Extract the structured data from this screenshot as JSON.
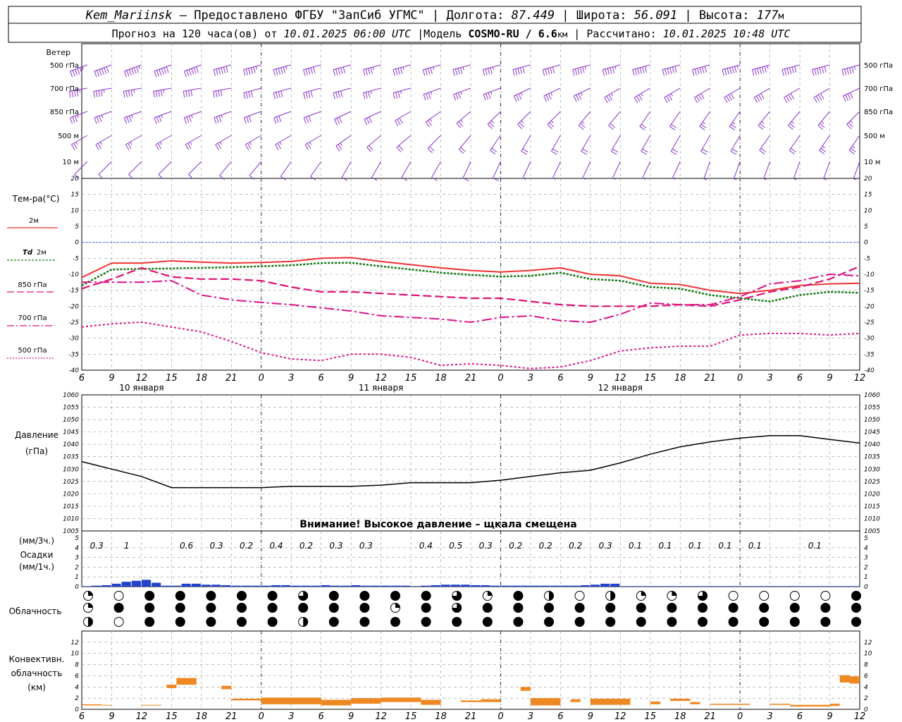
{
  "header": {
    "line1": {
      "station": "Kem_Mariinsk",
      "provider": "– Предоставлено ФГБУ \"ЗапСиб УГМС\"",
      "lon_label": "Долгота:",
      "lon": "87.449",
      "lat_label": "Широта:",
      "lat": "56.091",
      "alt_label": "Высота:",
      "alt": "177",
      "alt_unit": "м"
    },
    "line2": {
      "forecast_label": "Прогноз на 120 часа(ов) от",
      "forecast_time": "10.01.2025 06:00 UTC",
      "model_label": "|Модель",
      "model": "COSMO-RU / 6.6",
      "model_unit": "км",
      "calc_label": "| Рассчитано:",
      "calc_time": "10.01.2025 10:48 UTC"
    }
  },
  "labels": {
    "wind": "Ветер",
    "wind_levels": [
      "500 гПа",
      "700 гПа",
      "850 гПа",
      "500 м",
      "10 м"
    ],
    "temp": "Тем-ра(°С)",
    "legend_2m": "2м",
    "legend_td": "Td",
    "legend_td_2m": "2м",
    "legend_850": "850 гПа",
    "legend_700": "700 гПа",
    "legend_500": "500 гПа",
    "pressure_1": "Давление",
    "pressure_2": "(гПа)",
    "pressure_warning": "Внимание! Высокое давление – щкала смещена",
    "precip_1": "(мм/3ч.)",
    "precip_2": "Осадки",
    "precip_3": "(мм/1ч.)",
    "cloud": "Облачность",
    "conv_1": "Конвективн.",
    "conv_2": "облачность",
    "conv_3": "(км)"
  },
  "colors": {
    "temp2m": "#ee3333",
    "td2m": "#117711",
    "t850": "#dd1177",
    "t700": "#dd1188",
    "t500": "#dd1188",
    "wind": "#8833cc",
    "precip": "#2244cc",
    "conv": "#ee8822",
    "zero": "#3355ff"
  },
  "chart_data": [
    {
      "type": "line",
      "title": "Тем-ра(°С)",
      "x_hours": [
        0,
        3,
        6,
        9,
        12,
        15,
        18,
        21,
        24,
        27,
        30,
        33,
        36,
        39,
        42,
        45,
        48,
        51,
        54,
        57,
        60,
        63,
        66,
        69,
        72,
        75,
        78
      ],
      "x_tick_labels": [
        "6",
        "9",
        "12",
        "15",
        "18",
        "21",
        "0",
        "3",
        "6",
        "9",
        "12",
        "15",
        "18",
        "21",
        "0",
        "3",
        "6",
        "9",
        "12",
        "15",
        "18",
        "21",
        "0",
        "3",
        "6",
        "9",
        "12"
      ],
      "date_labels": [
        {
          "hour": 6,
          "text": "10 января"
        },
        {
          "hour": 30,
          "text": "11 января"
        },
        {
          "hour": 54,
          "text": "12 января"
        }
      ],
      "ylim": [
        -40,
        20
      ],
      "y_ticks": [
        20,
        15,
        10,
        5,
        0,
        -5,
        -10,
        -15,
        -20,
        -25,
        -30,
        -35,
        -40
      ],
      "series": [
        {
          "name": "2м",
          "values": [
            -11,
            -6.5,
            -6.5,
            -5.8,
            -6.2,
            -6.5,
            -6.3,
            -6,
            -5,
            -4.8,
            -6,
            -7,
            -8,
            -8.8,
            -9.3,
            -8.8,
            -8,
            -10,
            -10.5,
            -12.8,
            -13.2,
            -15,
            -16,
            -15,
            -13.5,
            -13,
            -12.8
          ]
        },
        {
          "name": "Td 2м",
          "values": [
            -13.5,
            -8.5,
            -8.3,
            -8.2,
            -8,
            -7.8,
            -7.5,
            -7.2,
            -6.5,
            -6.4,
            -7.5,
            -8.5,
            -9.5,
            -10.2,
            -10.7,
            -10.5,
            -9.5,
            -11.5,
            -12,
            -14,
            -14.5,
            -16.5,
            -17.5,
            -18.5,
            -16.5,
            -15.5,
            -15.8
          ]
        },
        {
          "name": "850 гПа",
          "values": [
            -14.5,
            -11.5,
            -8,
            -10.8,
            -11.5,
            -11.5,
            -12,
            -14,
            -15.5,
            -15.5,
            -16,
            -16.5,
            -17,
            -17.5,
            -17.5,
            -18.5,
            -19.5,
            -20,
            -20,
            -20,
            -19.5,
            -20,
            -18,
            -15.5,
            -14,
            -11.5,
            -7.5
          ]
        },
        {
          "name": "700 гПа",
          "values": [
            -12.5,
            -12.5,
            -12.5,
            -12,
            -16.5,
            -18,
            -18.8,
            -19.5,
            -20.5,
            -21.5,
            -23,
            -23.5,
            -24,
            -25,
            -23.5,
            -23,
            -24.5,
            -25,
            -22.5,
            -19,
            -19.5,
            -19.5,
            -17,
            -13,
            -12,
            -10,
            -10.5
          ]
        },
        {
          "name": "500 гПа",
          "values": [
            -26.5,
            -25.5,
            -25,
            -26.5,
            -28,
            -31,
            -34.5,
            -36.5,
            -37,
            -35,
            -35,
            -36,
            -38.5,
            -38,
            -38.5,
            -39.5,
            -39,
            -37,
            -34,
            -33,
            -32.5,
            -32.5,
            -29,
            -28.5,
            -28.5,
            -29,
            -28.5
          ]
        }
      ]
    },
    {
      "type": "line",
      "title": "Давление",
      "ylabel": "(гПа)",
      "x_hours": [
        0,
        3,
        6,
        9,
        12,
        15,
        18,
        21,
        24,
        27,
        30,
        33,
        36,
        39,
        42,
        45,
        48,
        51,
        54,
        57,
        60,
        63,
        66,
        69,
        72,
        75,
        78
      ],
      "ylim": [
        1005,
        1060
      ],
      "y_ticks": [
        1060,
        1055,
        1050,
        1045,
        1040,
        1035,
        1030,
        1025,
        1020,
        1015,
        1010,
        1005
      ],
      "series": [
        {
          "name": "Давление",
          "values": [
            1033,
            1030,
            1027,
            1022.5,
            1022.5,
            1022.5,
            1022.5,
            1023,
            1023,
            1023,
            1023.5,
            1024.5,
            1024.5,
            1024.5,
            1025.5,
            1027,
            1028.5,
            1029.5,
            1032.5,
            1036,
            1039,
            1041,
            1042.5,
            1043.5,
            1043.5,
            1042,
            1040.5
          ]
        }
      ]
    },
    {
      "type": "bar",
      "title": "Осадки",
      "ylim": [
        0,
        5
      ],
      "y_ticks": [
        5,
        4,
        3,
        2,
        1,
        0
      ],
      "three_hour_labels": [
        {
          "hour": 1.5,
          "text": "0.3"
        },
        {
          "hour": 4.5,
          "text": "1"
        },
        {
          "hour": 10.5,
          "text": "0.6"
        },
        {
          "hour": 13.5,
          "text": "0.3"
        },
        {
          "hour": 16.5,
          "text": "0.2"
        },
        {
          "hour": 19.5,
          "text": "0.4"
        },
        {
          "hour": 22.5,
          "text": "0.2"
        },
        {
          "hour": 25.5,
          "text": "0.3"
        },
        {
          "hour": 28.5,
          "text": "0.3"
        },
        {
          "hour": 34.5,
          "text": "0.4"
        },
        {
          "hour": 37.5,
          "text": "0.5"
        },
        {
          "hour": 40.5,
          "text": "0.3"
        },
        {
          "hour": 43.5,
          "text": "0.2"
        },
        {
          "hour": 46.5,
          "text": "0.2"
        },
        {
          "hour": 49.5,
          "text": "0.2"
        },
        {
          "hour": 52.5,
          "text": "0.3"
        },
        {
          "hour": 55.5,
          "text": "0.1"
        },
        {
          "hour": 58.5,
          "text": "0.1"
        },
        {
          "hour": 61.5,
          "text": "0.1"
        },
        {
          "hour": 64.5,
          "text": "0.1"
        },
        {
          "hour": 67.5,
          "text": "0.1"
        },
        {
          "hour": 73.5,
          "text": "0.1"
        }
      ],
      "hourly_mm": [
        0.05,
        0.1,
        0.15,
        0.3,
        0.5,
        0.6,
        0.7,
        0.4,
        0.1,
        0.1,
        0.3,
        0.3,
        0.2,
        0.2,
        0.15,
        0.1,
        0.1,
        0.1,
        0.1,
        0.15,
        0.15,
        0.1,
        0.1,
        0.1,
        0.15,
        0.1,
        0.1,
        0.15,
        0.1,
        0.1,
        0.1,
        0.1,
        0.1,
        0.05,
        0.1,
        0.15,
        0.2,
        0.2,
        0.2,
        0.15,
        0.15,
        0.1,
        0.1,
        0.1,
        0.1,
        0.1,
        0.1,
        0.1,
        0.1,
        0.1,
        0.15,
        0.2,
        0.3,
        0.3,
        0.05,
        0.05,
        0.05,
        0.05,
        0.05,
        0.05,
        0.05,
        0.05,
        0.05,
        0.05,
        0.05,
        0.05,
        0.05,
        0.05,
        0.05,
        0.05,
        0.05,
        0.05,
        0.05,
        0.05,
        0.05,
        0.05,
        0.05,
        0.05
      ]
    },
    {
      "type": "table",
      "title": "Облачность",
      "columns": 26,
      "rows": [
        "302222242222432101334000021102000000000000000000000000000000000000000000000000000000000000000000",
        "322222222232422222222222222222222222222222222222222222222222222222222222222222222222222222222223",
        "102222212222222222222222222222222222222222222222222222222222222222222222222222222222222222222222"
      ]
    },
    {
      "type": "bar",
      "title": "Конвективн. облачность",
      "ylabel": "(км)",
      "ylim": [
        0,
        14
      ],
      "y_ticks": [
        12,
        10,
        8,
        6,
        4,
        2,
        0
      ],
      "segments_km": [
        {
          "h0": 0,
          "h1": 2,
          "bottom": 0.7,
          "top": 0.9
        },
        {
          "h0": 2,
          "h1": 3,
          "bottom": 0.7,
          "top": 0.8
        },
        {
          "h0": 6,
          "h1": 8,
          "bottom": 0.7,
          "top": 0.8
        },
        {
          "h0": 8.5,
          "h1": 9.5,
          "bottom": 3.8,
          "top": 4.4
        },
        {
          "h0": 9.5,
          "h1": 11.5,
          "bottom": 4.4,
          "top": 5.6
        },
        {
          "h0": 14,
          "h1": 15,
          "bottom": 3.6,
          "top": 4.2
        },
        {
          "h0": 15,
          "h1": 18,
          "bottom": 1.6,
          "top": 1.9
        },
        {
          "h0": 18,
          "h1": 24,
          "bottom": 0.9,
          "top": 2.1
        },
        {
          "h0": 24,
          "h1": 27,
          "bottom": 0.7,
          "top": 1.7
        },
        {
          "h0": 27,
          "h1": 30,
          "bottom": 1,
          "top": 2
        },
        {
          "h0": 30,
          "h1": 34,
          "bottom": 1.3,
          "top": 2.1
        },
        {
          "h0": 34,
          "h1": 36,
          "bottom": 0.8,
          "top": 1.7
        },
        {
          "h0": 38,
          "h1": 40,
          "bottom": 1.3,
          "top": 1.6
        },
        {
          "h0": 40,
          "h1": 42,
          "bottom": 1.3,
          "top": 1.8
        },
        {
          "h0": 44,
          "h1": 45,
          "bottom": 3.3,
          "top": 4
        },
        {
          "h0": 45,
          "h1": 48,
          "bottom": 0.7,
          "top": 2
        },
        {
          "h0": 49,
          "h1": 50,
          "bottom": 1.3,
          "top": 1.8
        },
        {
          "h0": 51,
          "h1": 55,
          "bottom": 0.8,
          "top": 1.9
        },
        {
          "h0": 57,
          "h1": 58,
          "bottom": 0.9,
          "top": 1.4
        },
        {
          "h0": 59,
          "h1": 61,
          "bottom": 1.5,
          "top": 1.9
        },
        {
          "h0": 61,
          "h1": 62,
          "bottom": 0.9,
          "top": 1.3
        },
        {
          "h0": 63,
          "h1": 67,
          "bottom": 0.8,
          "top": 1
        },
        {
          "h0": 69,
          "h1": 71,
          "bottom": 0.8,
          "top": 1
        },
        {
          "h0": 71,
          "h1": 75,
          "bottom": 0.5,
          "top": 0.8
        },
        {
          "h0": 75,
          "h1": 76,
          "bottom": 0.6,
          "top": 1
        },
        {
          "h0": 76,
          "h1": 77,
          "bottom": 4.8,
          "top": 6.1
        },
        {
          "h0": 77,
          "h1": 78,
          "bottom": 4.6,
          "top": 5.9
        }
      ]
    },
    {
      "type": "scatter",
      "title": "Ветер",
      "levels": [
        "500 гПа",
        "700 гПа",
        "850 гПа",
        "500 м",
        "10 м"
      ],
      "dir_deg": [
        [
          250,
          250,
          250,
          250,
          250,
          255,
          255,
          255,
          255,
          255,
          255,
          255,
          255,
          255,
          255,
          255,
          255,
          255,
          255,
          255,
          255,
          255,
          255,
          255,
          255,
          255,
          255
        ],
        [
          260,
          260,
          260,
          260,
          260,
          260,
          255,
          255,
          255,
          255,
          255,
          255,
          250,
          250,
          250,
          245,
          245,
          245,
          240,
          240,
          240,
          240,
          240,
          240,
          240,
          240,
          245
        ],
        [
          250,
          250,
          250,
          250,
          250,
          250,
          250,
          250,
          250,
          245,
          245,
          240,
          235,
          230,
          225,
          225,
          225,
          220,
          220,
          215,
          215,
          215,
          215,
          220,
          220,
          220,
          225
        ],
        [
          240,
          240,
          240,
          240,
          240,
          240,
          240,
          240,
          240,
          235,
          230,
          230,
          225,
          220,
          215,
          210,
          210,
          210,
          210,
          210,
          210,
          210,
          210,
          215,
          215,
          215,
          215
        ],
        [
          225,
          225,
          225,
          225,
          225,
          220,
          220,
          215,
          215,
          210,
          210,
          210,
          210,
          205,
          205,
          205,
          205,
          205,
          205,
          205,
          205,
          200,
          200,
          200,
          200,
          200,
          200
        ]
      ],
      "speed_kt": [
        [
          55,
          60,
          65,
          60,
          60,
          60,
          55,
          55,
          50,
          50,
          45,
          45,
          45,
          45,
          45,
          50,
          50,
          55,
          55,
          60,
          60,
          60,
          65,
          65,
          60,
          60,
          55
        ],
        [
          45,
          45,
          45,
          45,
          40,
          40,
          40,
          40,
          40,
          40,
          35,
          35,
          35,
          35,
          35,
          35,
          35,
          35,
          35,
          35,
          35,
          40,
          40,
          40,
          40,
          40,
          40
        ],
        [
          35,
          35,
          35,
          35,
          35,
          35,
          30,
          30,
          30,
          30,
          30,
          30,
          25,
          25,
          25,
          25,
          25,
          25,
          20,
          20,
          20,
          25,
          25,
          25,
          25,
          25,
          25
        ],
        [
          25,
          25,
          25,
          25,
          25,
          25,
          25,
          25,
          25,
          25,
          20,
          20,
          20,
          20,
          20,
          20,
          20,
          20,
          20,
          20,
          20,
          20,
          20,
          20,
          20,
          25,
          25
        ],
        [
          10,
          10,
          10,
          10,
          10,
          10,
          10,
          10,
          10,
          10,
          10,
          10,
          10,
          10,
          10,
          5,
          5,
          5,
          5,
          5,
          5,
          5,
          5,
          5,
          5,
          5,
          5
        ]
      ]
    }
  ]
}
